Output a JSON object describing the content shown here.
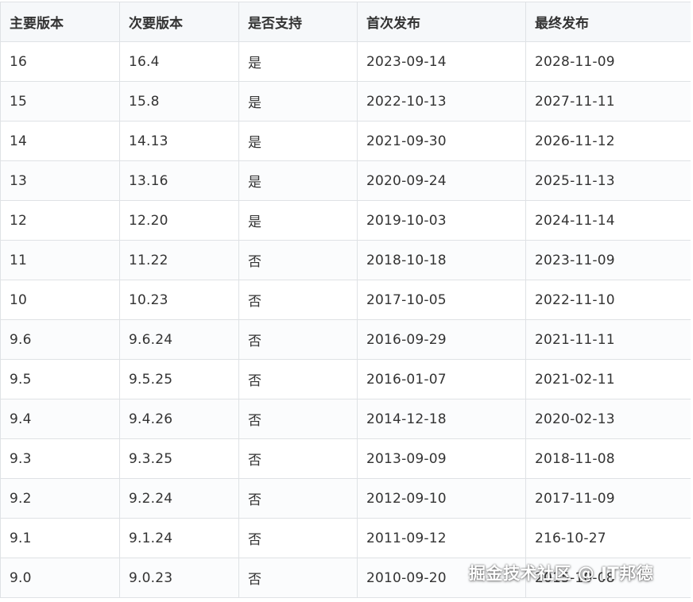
{
  "headers": [
    "主要版本",
    "次要版本",
    "是否支持",
    "首次发布",
    "最终发布"
  ],
  "rows": [
    [
      "16",
      "16.4",
      "是",
      "2023-09-14",
      "2028-11-09"
    ],
    [
      "15",
      "15.8",
      "是",
      "2022-10-13",
      "2027-11-11"
    ],
    [
      "14",
      "14.13",
      "是",
      "2021-09-30",
      "2026-11-12"
    ],
    [
      "13",
      "13.16",
      "是",
      "2020-09-24",
      "2025-11-13"
    ],
    [
      "12",
      "12.20",
      "是",
      "2019-10-03",
      "2024-11-14"
    ],
    [
      "11",
      "11.22",
      "否",
      "2018-10-18",
      "2023-11-09"
    ],
    [
      "10",
      "10.23",
      "否",
      "2017-10-05",
      "2022-11-10"
    ],
    [
      "9.6",
      "9.6.24",
      "否",
      "2016-09-29",
      "2021-11-11"
    ],
    [
      "9.5",
      "9.5.25",
      "否",
      "2016-01-07",
      "2021-02-11"
    ],
    [
      "9.4",
      "9.4.26",
      "否",
      "2014-12-18",
      "2020-02-13"
    ],
    [
      "9.3",
      "9.3.25",
      "否",
      "2013-09-09",
      "2018-11-08"
    ],
    [
      "9.2",
      "9.2.24",
      "否",
      "2012-09-10",
      "2017-11-09"
    ],
    [
      "9.1",
      "9.1.24",
      "否",
      "2011-09-12",
      "216-10-27"
    ],
    [
      "9.0",
      "9.0.23",
      "否",
      "2010-09-20",
      "2015-10-08"
    ]
  ],
  "watermark": "掘金技术社区 @ IT邦德"
}
